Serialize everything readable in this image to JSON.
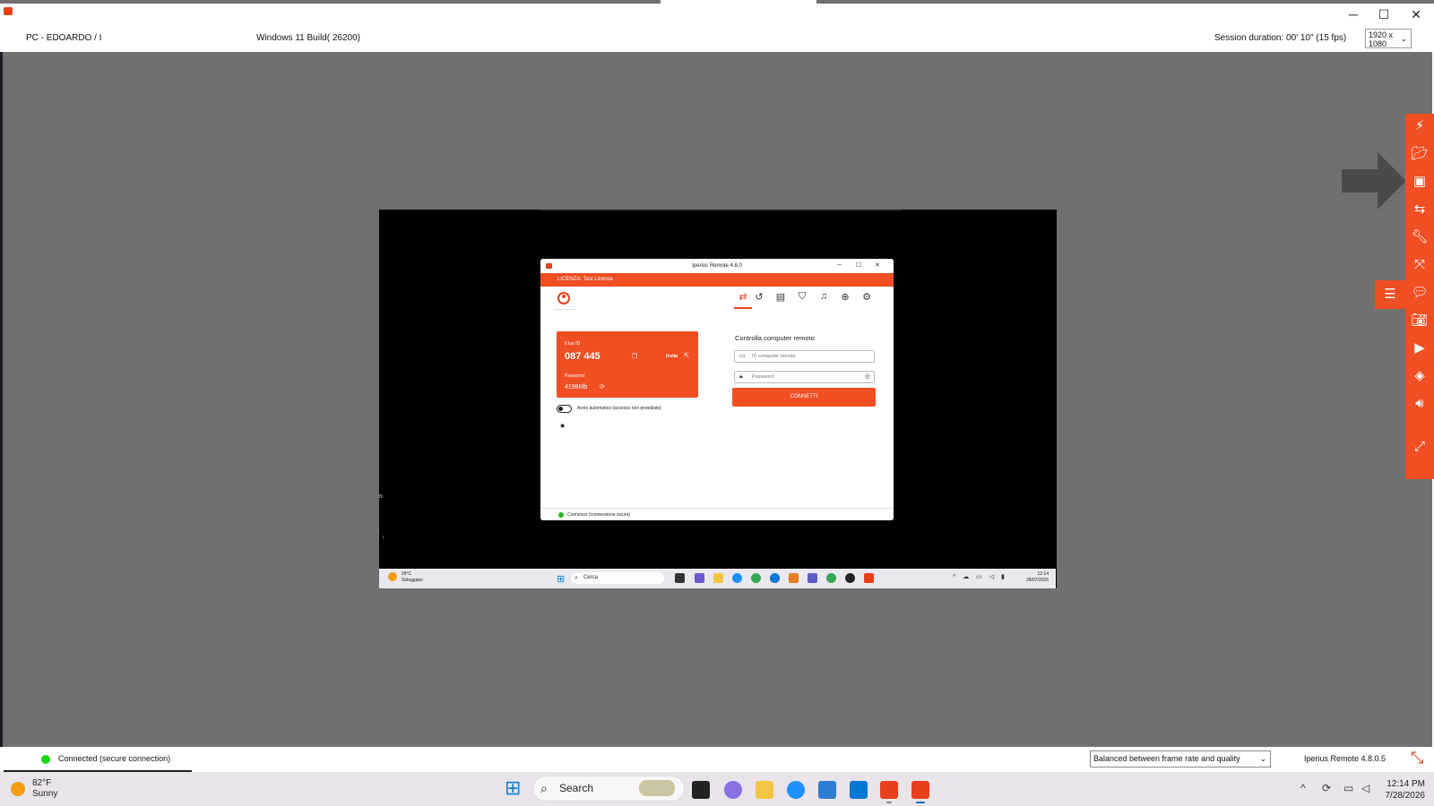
{
  "window": {
    "minimize": "─",
    "maximize": "☐",
    "close": "✕"
  },
  "info_bar": {
    "pc_name": "PC - EDOARDO / I",
    "os": "Windows 11 Build( 26200)",
    "session": "Session duration: 00' 10\" (15 fps)",
    "resolution": "1920 x 1080"
  },
  "remote": {
    "app": {
      "title": "Iperius Remote 4.8.0",
      "license": "LICENZA: Test License",
      "your_id_label": "Il tuo ID",
      "your_id": "087 445",
      "invite": "Invita",
      "password_label": "Password",
      "password": "41986fb",
      "auto_start": "Avvio automatico (accesso non presidiato)",
      "control_title": "Controlla computer remoto",
      "remote_id_placeholder": "ID computer remoto",
      "password_placeholder": "Password",
      "connect": "CONNETTI",
      "status": "Connesso (connessione sicura)"
    },
    "taskbar": {
      "temp": "28°C",
      "condition": "Soleggiato",
      "search": "Cerca",
      "time": "12:14",
      "date": "28/07/2026"
    }
  },
  "toolbar_icons": [
    "lightning-icon",
    "folder-icon",
    "address-book-icon",
    "switch-icon",
    "wrench-icon",
    "fullscreen-icon",
    "chat-icon",
    "camera-icon",
    "video-icon",
    "hide-icon",
    "volume-icon",
    "expand-icon"
  ],
  "status_bar": {
    "status": "Connected (secure connection)",
    "quality": "Balanced between frame rate and quality",
    "version": "Iperius Remote 4.8.0.5"
  },
  "host_taskbar": {
    "temp": "82°F",
    "condition": "Sunny",
    "search": "Search",
    "time": "12:14 PM",
    "date": "7/28/2026"
  },
  "colors": {
    "accent": "#f04e23",
    "connected": "#18d618"
  }
}
